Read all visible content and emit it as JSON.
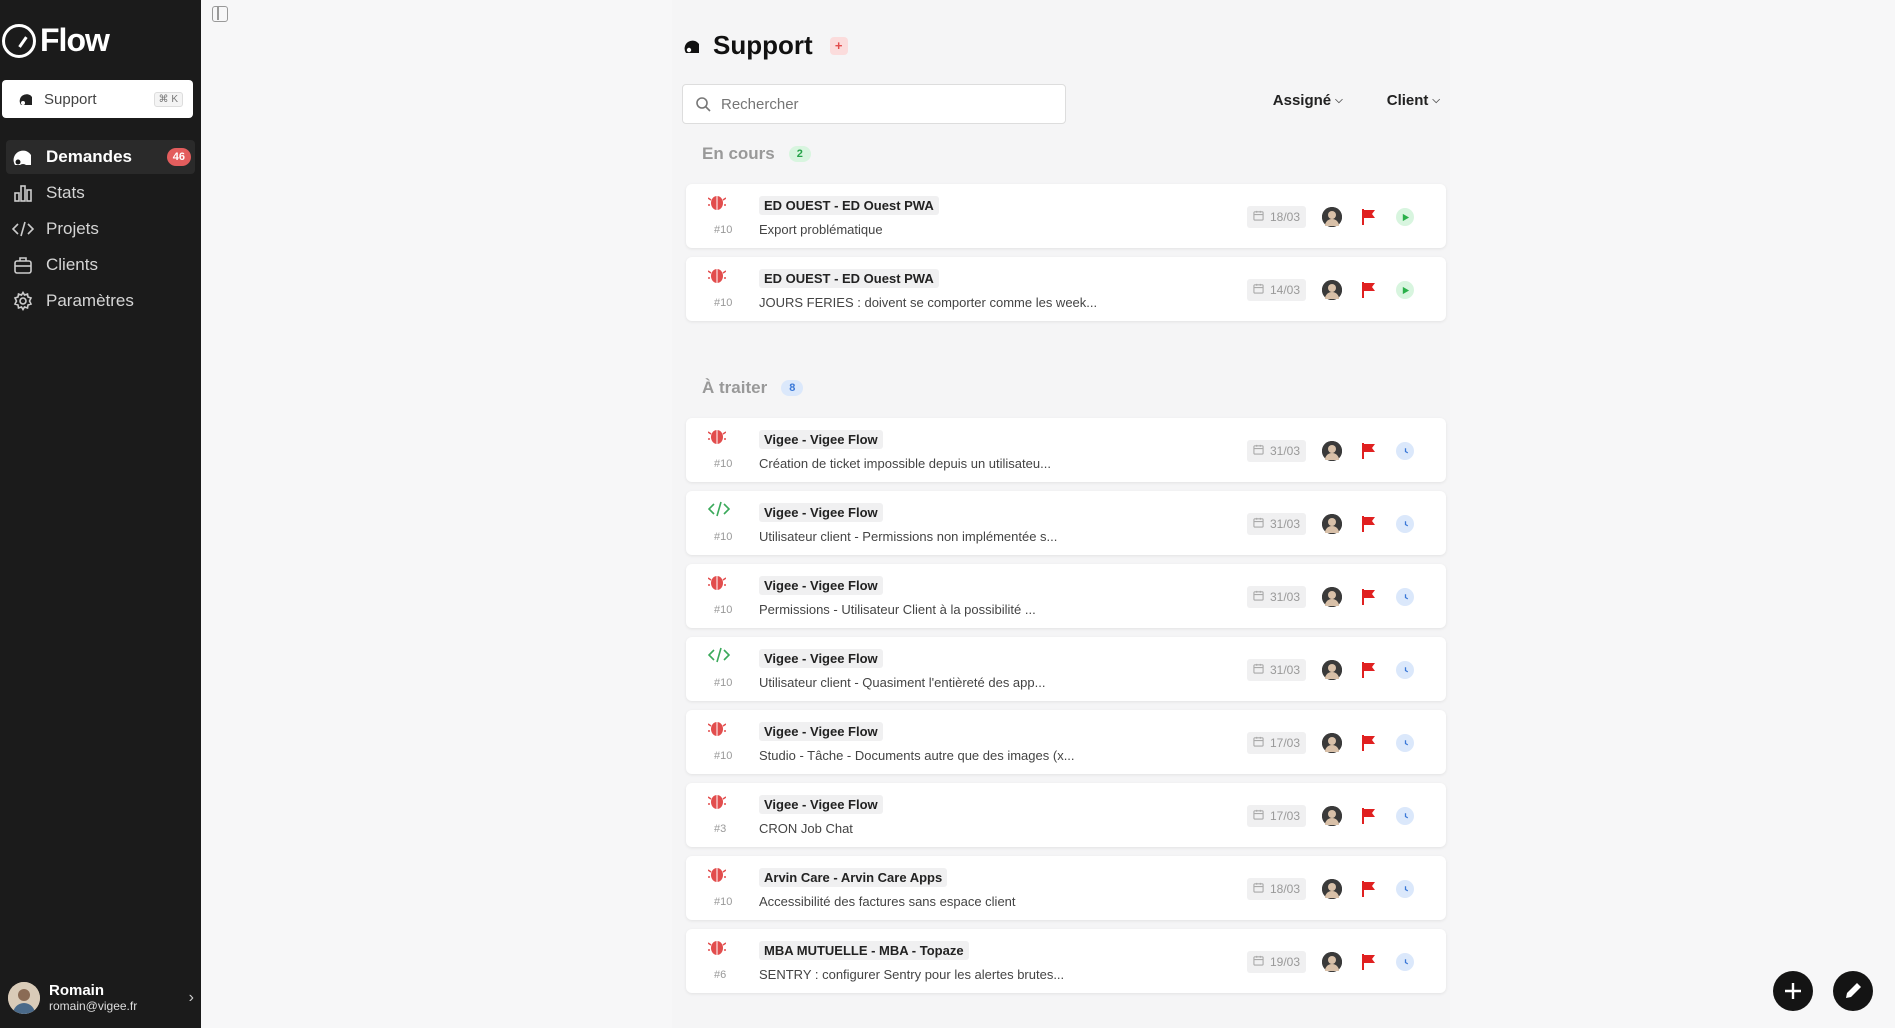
{
  "app": {
    "name": "Flow"
  },
  "workspace": {
    "label": "Support",
    "shortcut": "⌘ K"
  },
  "nav": [
    {
      "label": "Demandes",
      "icon": "requests-icon",
      "badge": "46",
      "active": true
    },
    {
      "label": "Stats",
      "icon": "stats-icon"
    },
    {
      "label": "Projets",
      "icon": "code-icon"
    },
    {
      "label": "Clients",
      "icon": "briefcase-icon"
    },
    {
      "label": "Paramètres",
      "icon": "gear-icon"
    }
  ],
  "user": {
    "name": "Romain",
    "email": "romain@vigee.fr"
  },
  "page": {
    "title": "Support",
    "add_label": "+"
  },
  "search": {
    "placeholder": "Rechercher"
  },
  "filters": {
    "assignee": "Assigné",
    "client": "Client"
  },
  "sections": {
    "in_progress": {
      "title": "En cours",
      "count": "2",
      "cards": [
        {
          "type": "bug",
          "number": "#10",
          "project": "ED OUEST - ED Ouest PWA",
          "title": "Export problématique",
          "date": "18/03",
          "status": "in-progress"
        },
        {
          "type": "bug",
          "number": "#10",
          "project": "ED OUEST - ED Ouest PWA",
          "title": "JOURS FERIES : doivent se comporter comme les week...",
          "date": "14/03",
          "status": "in-progress"
        }
      ]
    },
    "todo": {
      "title": "À traiter",
      "count": "8",
      "cards": [
        {
          "type": "bug",
          "number": "#10",
          "project": "Vigee - Vigee Flow",
          "title": "Création de ticket impossible depuis un utilisateu...",
          "date": "31/03",
          "status": "pending"
        },
        {
          "type": "code",
          "number": "#10",
          "project": "Vigee - Vigee Flow",
          "title": "Utilisateur client - Permissions non implémentée s...",
          "date": "31/03",
          "status": "pending"
        },
        {
          "type": "bug",
          "number": "#10",
          "project": "Vigee - Vigee Flow",
          "title": "Permissions - Utilisateur Client à la possibilité ...",
          "date": "31/03",
          "status": "pending"
        },
        {
          "type": "code",
          "number": "#10",
          "project": "Vigee - Vigee Flow",
          "title": "Utilisateur client - Quasiment l'entièreté des app...",
          "date": "31/03",
          "status": "pending"
        },
        {
          "type": "bug",
          "number": "#10",
          "project": "Vigee - Vigee Flow",
          "title": "Studio - Tâche - Documents autre que des images (x...",
          "date": "17/03",
          "status": "pending"
        },
        {
          "type": "bug",
          "number": "#3",
          "project": "Vigee - Vigee Flow",
          "title": "CRON Job Chat",
          "date": "17/03",
          "status": "pending"
        },
        {
          "type": "bug",
          "number": "#10",
          "project": "Arvin Care - Arvin Care Apps",
          "title": "Accessibilité des factures sans espace client",
          "date": "18/03",
          "status": "pending"
        },
        {
          "type": "bug",
          "number": "#6",
          "project": "MBA MUTUELLE - MBA - Topaze",
          "title": "SENTRY : configurer Sentry pour les alertes brutes...",
          "date": "19/03",
          "status": "pending"
        }
      ]
    }
  },
  "colors": {
    "accent_red": "#e24d4d",
    "sidebar_bg": "#1b1b1b",
    "green": "#27a349",
    "blue": "#3a78d8"
  }
}
